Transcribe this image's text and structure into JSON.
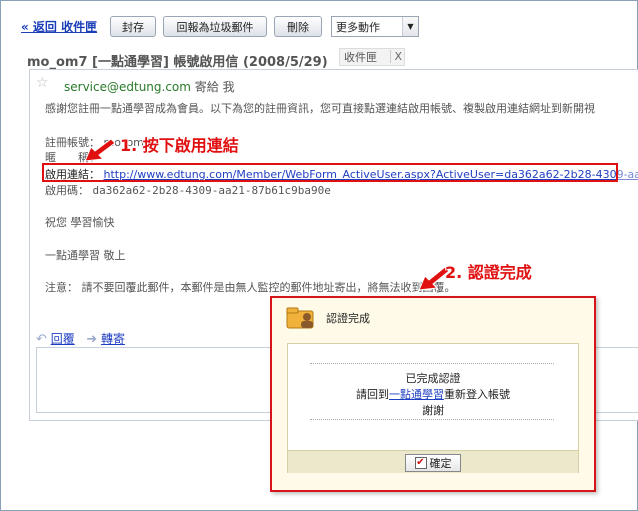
{
  "toolbar": {
    "back_label": "« 返回 收件匣",
    "archive_label": "封存",
    "report_spam_label": "回報為垃圾郵件",
    "delete_label": "刪除",
    "more_actions_label": "更多動作"
  },
  "message": {
    "subject": "mo_om7 [一點通學習] 帳號啟用信 (2008/5/29)",
    "label_chip": "收件匣",
    "label_chip_close": "X",
    "sender": "service@edtung.com",
    "to_me": "寄給 我",
    "intro": "感謝您註冊一點通學習成為會員。以下為您的註冊資訊，您可直接點選連結啟用帳號、複製啟用連結網址到新開視",
    "account_label": "註冊帳號：",
    "account_value": "mo_om7",
    "nickname_label": "暱　　稱：",
    "activation_label": "啟用連結：",
    "activation_url": "http://www.edtung.com/Member/WebForm_ActiveUser.aspx?ActiveUser=da362a62-2b28-430",
    "activation_url_tail": "9-aa",
    "code_label": "啟用碼：",
    "code_value": "da362a62-2b28-4309-aa21-87b61c9ba90e",
    "wish": "祝您 學習愉快",
    "signature": "一點通學習 敬上",
    "notice": "注意： 請不要回覆此郵件，本郵件是由無人監控的郵件地址寄出，將無法收到回覆。",
    "reply_label": "回覆",
    "forward_label": "轉寄"
  },
  "annotations": {
    "step1": "1. 按下啟用連結",
    "step2": "2. 認證完成"
  },
  "dialog": {
    "title": "認證完成",
    "line1": "已完成認證",
    "line2_prefix": "請回到",
    "line2_link": "一點通學習",
    "line2_suffix": "重新登入帳號",
    "line3": "謝謝",
    "ok_label": "確定"
  },
  "colors": {
    "annotation_red": "#e01010",
    "link_blue": "#1f3fc2",
    "sender_green": "#2a7a2a",
    "dialog_bg": "#fffbe8"
  },
  "icons": [
    "star-icon",
    "folder-user-icon",
    "reply-arrow-icon",
    "forward-arrow-icon",
    "check-icon",
    "dropdown-arrow-icon",
    "red-pointer-arrow-icon"
  ]
}
